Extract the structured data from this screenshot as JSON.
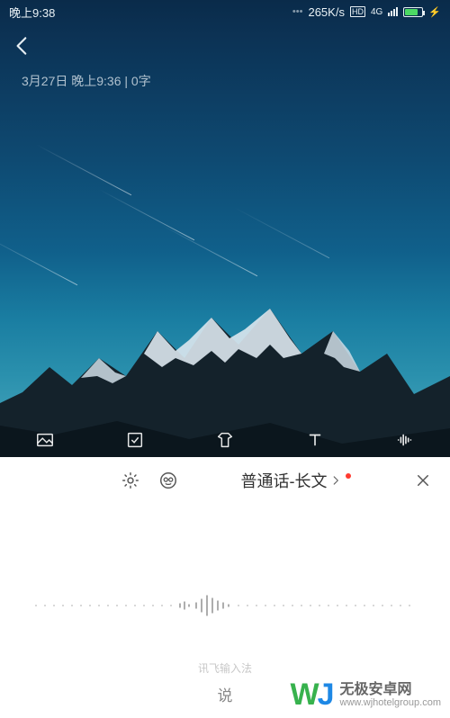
{
  "status": {
    "time": "晚上9:38",
    "net_speed": "265K/s",
    "net_type": "4G",
    "volte": true,
    "battery_charging": true
  },
  "note": {
    "meta_line": "3月27日 晚上9:36 | 0字"
  },
  "toolbar": {
    "icons": [
      "image-icon",
      "checklist-icon",
      "theme-icon",
      "text-style-icon",
      "voice-wave-icon"
    ]
  },
  "ime": {
    "settings_icon": "gear-icon",
    "emoji_icon": "emoji-glasses-icon",
    "language_label": "普通话-长文",
    "has_notification_dot": true,
    "close_icon": "close-icon",
    "footer_brand": "讯飞输入法",
    "footer_hint": "说"
  },
  "watermark": {
    "cn": "无极安卓网",
    "en": "www.wjhotelgroup.com"
  }
}
